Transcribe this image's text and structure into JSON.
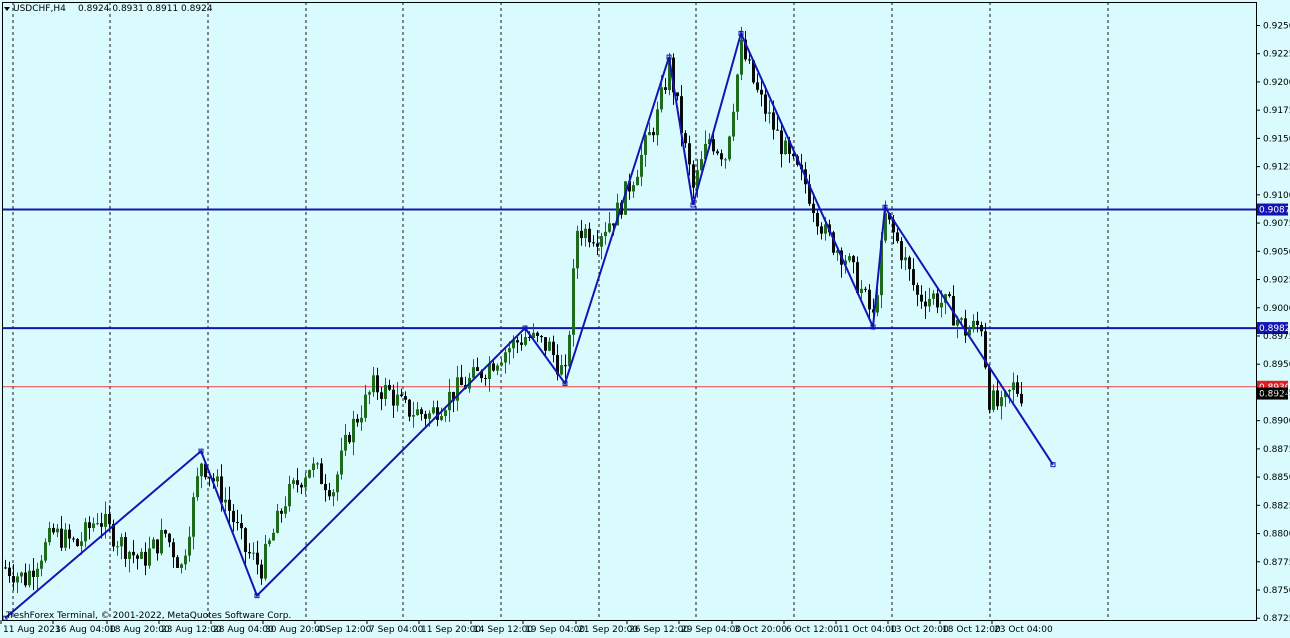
{
  "window": {
    "symbol_header": "USDCHF,H4",
    "ohlc": "0.8924 0.8931 0.8911 0.8924",
    "copyright": "TreshForex Terminal, © 2001-2022, MetaQuotes Software Corp."
  },
  "colors": {
    "background": "#d9fbfd",
    "grid": "#1a1a1a",
    "bull": "#1e6b1e",
    "bear": "#0a0a0a",
    "zigzag": "#1414b4",
    "level_line": "#1414b4",
    "bid_line": "#f04040",
    "level_label_bg": "#1414b4",
    "bid_label_bg": "#e02020",
    "price_label_bg": "#000000"
  },
  "price_axis": {
    "ticks": [
      "0.9250",
      "0.9225",
      "0.9200",
      "0.9175",
      "0.9150",
      "0.9125",
      "0.9100",
      "0.9075",
      "0.9050",
      "0.9025",
      "0.9000",
      "0.8975",
      "0.8950",
      "0.8925",
      "0.8900",
      "0.8875",
      "0.8850",
      "0.8825",
      "0.8800",
      "0.8775",
      "0.8750",
      "0.8725"
    ]
  },
  "time_axis": {
    "labels": [
      "11 Aug 2023",
      "16 Aug 04:00",
      "18 Aug 20:00",
      "23 Aug 12:00",
      "28 Aug 04:00",
      "30 Aug 20:00",
      "4 Sep 12:00",
      "7 Sep 04:00",
      "11 Sep 20:00",
      "14 Sep 12:00",
      "19 Sep 04:00",
      "21 Sep 20:00",
      "26 Sep 12:00",
      "29 Sep 04:00",
      "3 Oct 20:00",
      "6 Oct 12:00",
      "11 Oct 04:00",
      "13 Oct 20:00",
      "18 Oct 12:00",
      "23 Oct 04:00"
    ]
  },
  "levels": [
    {
      "price": 0.9087,
      "label": "0.9087"
    },
    {
      "price": 0.8982,
      "label": "0.8982"
    }
  ],
  "bid": {
    "price": 0.893,
    "label": "0.8930"
  },
  "current_price": {
    "price": 0.8924,
    "label": "0.8924"
  },
  "chart_data": {
    "type": "candlestick",
    "symbol": "USDCHF",
    "timeframe": "H4",
    "ylim": [
      0.872,
      0.9265
    ],
    "grid": true,
    "zigzag": [
      {
        "bar": 0,
        "price": 0.8725
      },
      {
        "bar": 49,
        "price": 0.8873
      },
      {
        "bar": 63,
        "price": 0.8745
      },
      {
        "bar": 130,
        "price": 0.8982
      },
      {
        "bar": 140,
        "price": 0.8933
      },
      {
        "bar": 166,
        "price": 0.9222
      },
      {
        "bar": 172,
        "price": 0.9091
      },
      {
        "bar": 184,
        "price": 0.9243
      },
      {
        "bar": 217,
        "price": 0.8983
      },
      {
        "bar": 220,
        "price": 0.9089
      },
      {
        "bar": 262,
        "price": 0.8861
      }
    ],
    "candle_anchors": [
      {
        "bar": 0,
        "price": 0.877
      },
      {
        "bar": 5,
        "price": 0.876
      },
      {
        "bar": 12,
        "price": 0.88
      },
      {
        "bar": 18,
        "price": 0.879
      },
      {
        "bar": 23,
        "price": 0.8815
      },
      {
        "bar": 28,
        "price": 0.8795
      },
      {
        "bar": 34,
        "price": 0.8775
      },
      {
        "bar": 40,
        "price": 0.88
      },
      {
        "bar": 44,
        "price": 0.877
      },
      {
        "bar": 49,
        "price": 0.8865
      },
      {
        "bar": 55,
        "price": 0.883
      },
      {
        "bar": 60,
        "price": 0.8785
      },
      {
        "bar": 64,
        "price": 0.877
      },
      {
        "bar": 70,
        "price": 0.883
      },
      {
        "bar": 76,
        "price": 0.886
      },
      {
        "bar": 82,
        "price": 0.884
      },
      {
        "bar": 86,
        "price": 0.889
      },
      {
        "bar": 92,
        "price": 0.893
      },
      {
        "bar": 96,
        "price": 0.8925
      },
      {
        "bar": 100,
        "price": 0.891
      },
      {
        "bar": 106,
        "price": 0.8905
      },
      {
        "bar": 112,
        "price": 0.8925
      },
      {
        "bar": 118,
        "price": 0.894
      },
      {
        "bar": 124,
        "price": 0.896
      },
      {
        "bar": 130,
        "price": 0.8975
      },
      {
        "bar": 136,
        "price": 0.8965
      },
      {
        "bar": 140,
        "price": 0.8938
      },
      {
        "bar": 143,
        "price": 0.907
      },
      {
        "bar": 148,
        "price": 0.9065
      },
      {
        "bar": 153,
        "price": 0.9085
      },
      {
        "bar": 158,
        "price": 0.9125
      },
      {
        "bar": 163,
        "price": 0.917
      },
      {
        "bar": 166,
        "price": 0.9215
      },
      {
        "bar": 170,
        "price": 0.914
      },
      {
        "bar": 172,
        "price": 0.9105
      },
      {
        "bar": 176,
        "price": 0.915
      },
      {
        "bar": 180,
        "price": 0.9135
      },
      {
        "bar": 184,
        "price": 0.923
      },
      {
        "bar": 188,
        "price": 0.919
      },
      {
        "bar": 192,
        "price": 0.916
      },
      {
        "bar": 196,
        "price": 0.913
      },
      {
        "bar": 200,
        "price": 0.911
      },
      {
        "bar": 205,
        "price": 0.9065
      },
      {
        "bar": 210,
        "price": 0.9045
      },
      {
        "bar": 214,
        "price": 0.9015
      },
      {
        "bar": 217,
        "price": 0.899
      },
      {
        "bar": 220,
        "price": 0.908
      },
      {
        "bar": 224,
        "price": 0.905
      },
      {
        "bar": 228,
        "price": 0.901
      },
      {
        "bar": 232,
        "price": 0.901
      },
      {
        "bar": 236,
        "price": 0.9
      },
      {
        "bar": 240,
        "price": 0.898
      },
      {
        "bar": 244,
        "price": 0.8985
      },
      {
        "bar": 246,
        "price": 0.892
      },
      {
        "bar": 249,
        "price": 0.891
      },
      {
        "bar": 252,
        "price": 0.893
      },
      {
        "bar": 254,
        "price": 0.8924
      }
    ],
    "last_bar": 254
  }
}
